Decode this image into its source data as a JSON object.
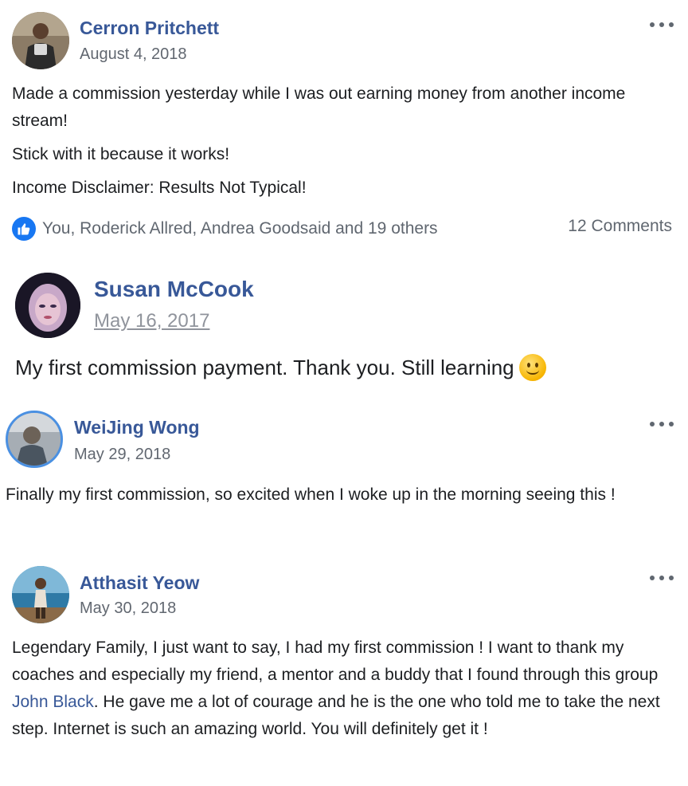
{
  "posts": [
    {
      "author": "Cerron Pritchett",
      "date": "August 4, 2018",
      "paragraphs": [
        "Made a commission yesterday while I was out earning money from another income stream!",
        "Stick with it because it works!",
        "Income Disclaimer: Results Not Typical!"
      ],
      "reactions_text": "You, Roderick Allred, Andrea Goodsaid and 19 others",
      "comments_text": "12 Comments",
      "more_icon": "more-options-icon"
    },
    {
      "author": "Susan McCook",
      "date": "May 16, 2017",
      "text": "My first commission payment. Thank you. Still learning",
      "emoji": "smiley-face-emoji"
    },
    {
      "author": "WeiJing Wong",
      "date": "May 29, 2018",
      "text": "Finally my first commission, so excited when I woke up in the morning seeing this !",
      "more_icon": "more-options-icon"
    },
    {
      "author": "Atthasit Yeow",
      "date": "May 30, 2018",
      "text_before": "Legendary Family, I just want to say, I had my first commission ! I want to thank my coaches and especially my friend, a mentor and a buddy that I found through this group ",
      "mention": "John Black",
      "text_after": ". He gave me a lot of courage and he is the one who told me to take the next step. Internet is such an amazing world. You will definitely get it !",
      "more_icon": "more-options-icon"
    }
  ],
  "colors": {
    "name_link": "#385898",
    "like_badge": "#1877f2",
    "meta_text": "#616770"
  }
}
